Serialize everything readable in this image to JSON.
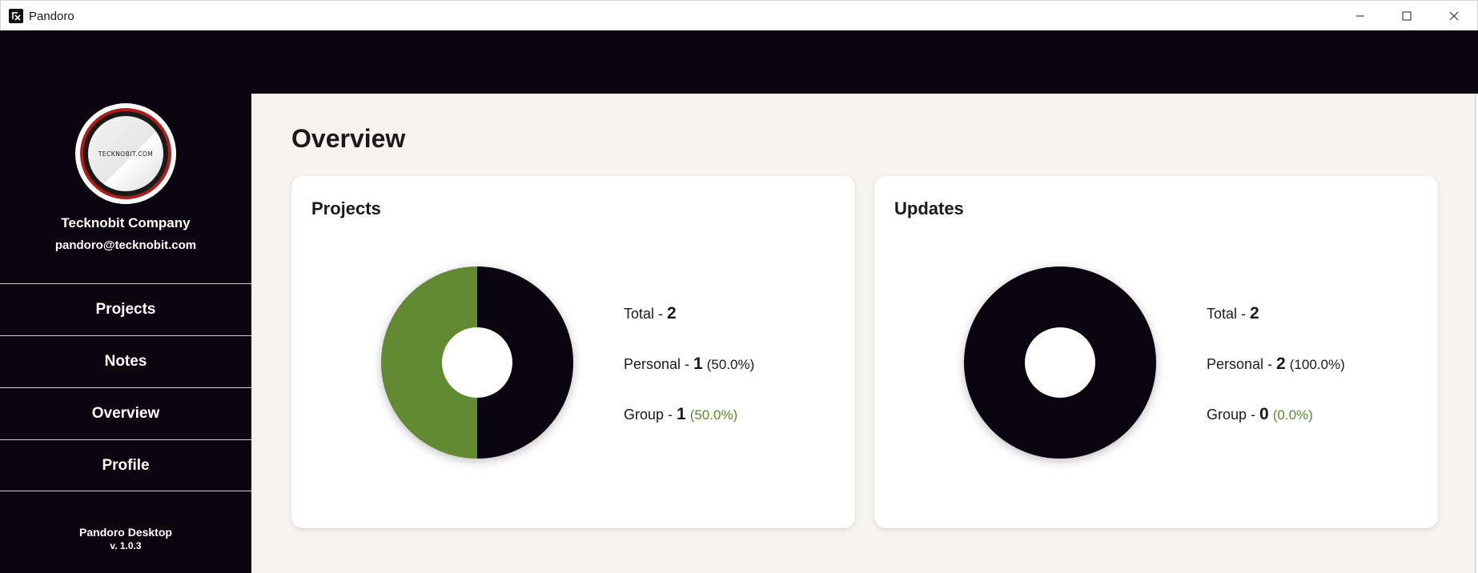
{
  "window": {
    "title": "Pandoro"
  },
  "sidebar": {
    "avatar_text": "TECKNOBIT.COM",
    "company": "Tecknobit Company",
    "email": "pandoro@tecknobit.com",
    "nav": [
      {
        "label": "Projects"
      },
      {
        "label": "Notes"
      },
      {
        "label": "Overview"
      },
      {
        "label": "Profile"
      }
    ],
    "app_name": "Pandoro Desktop",
    "app_version": "v. 1.0.3"
  },
  "main": {
    "title": "Overview",
    "cards": [
      {
        "title": "Projects",
        "total_label": "Total - ",
        "total": "2",
        "personal_label": "Personal - ",
        "personal": "1",
        "personal_pct": "(50.0%)",
        "group_label": "Group - ",
        "group": "1",
        "group_pct": "(50.0%)"
      },
      {
        "title": "Updates",
        "total_label": "Total - ",
        "total": "2",
        "personal_label": "Personal - ",
        "personal": "2",
        "personal_pct": "(100.0%)",
        "group_label": "Group - ",
        "group": "0",
        "group_pct": "(0.0%)"
      }
    ]
  },
  "chart_data": [
    {
      "type": "pie",
      "categories": [
        "Personal",
        "Group"
      ],
      "values": [
        1,
        1
      ],
      "colors": [
        "#0a0610",
        "#628a32"
      ]
    },
    {
      "type": "pie",
      "categories": [
        "Personal",
        "Group"
      ],
      "values": [
        2,
        0
      ],
      "colors": [
        "#0a0610",
        "#628a32"
      ]
    }
  ]
}
